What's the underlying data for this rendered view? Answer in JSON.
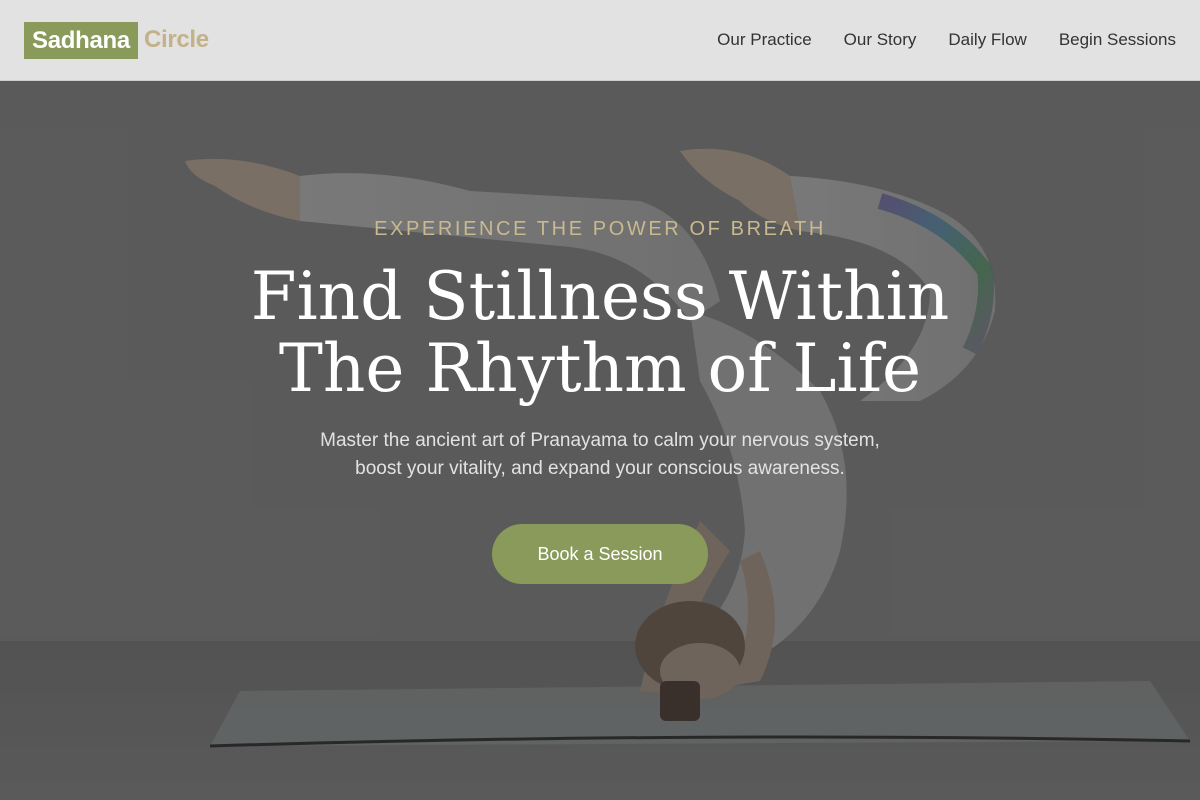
{
  "brand": {
    "part1": "Sadhana",
    "part2": "Circle"
  },
  "nav": {
    "items": [
      {
        "label": "Our Practice"
      },
      {
        "label": "Our Story"
      },
      {
        "label": "Daily Flow"
      },
      {
        "label": "Begin Sessions"
      }
    ]
  },
  "hero": {
    "eyebrow": "EXPERIENCE THE POWER OF BREATH",
    "headline_line1": "Find Stillness Within",
    "headline_line2": "The Rhythm of Life",
    "subtext_line1": "Master the ancient art of Pranayama to calm your nervous system,",
    "subtext_line2": "boost your vitality, and expand your conscious awareness.",
    "cta_label": "Book a Session",
    "background_image": "yoga-headstand-photo"
  },
  "colors": {
    "accent": "#8a9a5b",
    "accent_light": "#c3b188",
    "nav_bg": "#e2e2e2",
    "text_dark": "#333333"
  }
}
